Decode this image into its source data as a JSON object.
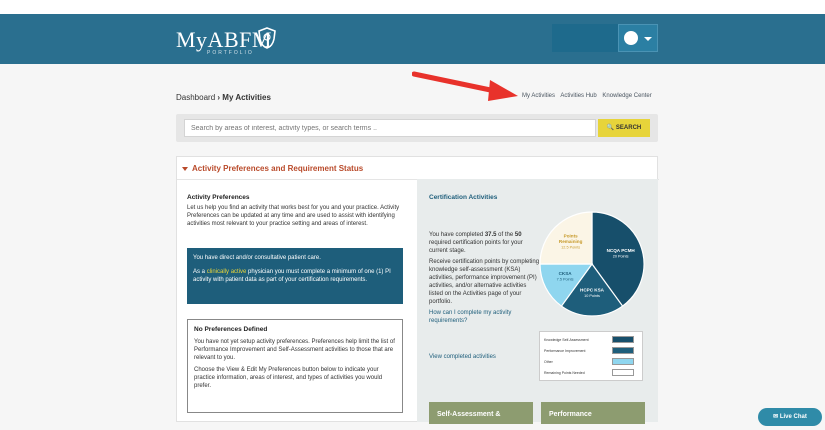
{
  "header": {
    "logo_text": "MyABFM",
    "logo_subtext": "PORTFOLIO"
  },
  "breadcrumb": {
    "home": "Dashboard",
    "separator": "›",
    "current": "My Activities"
  },
  "top_links": [
    "My Activities",
    "Activities Hub",
    "Knowledge Center"
  ],
  "search": {
    "placeholder": "Search by areas of interest, activity types, or search terms ..",
    "button_label": "SEARCH",
    "icon": "search-icon"
  },
  "section": {
    "title": "Activity Preferences and Requirement Status",
    "preferences": {
      "title": "Activity Preferences",
      "text": "Let us help you find an activity that works best for you and your practice. Activity Preferences can be updated at any time and are used to assist with identifying activities most relevant to your practice setting and areas of interest.",
      "notice_line1": "You have direct and/or consultative patient care.",
      "notice_pre": "As a ",
      "notice_highlight": "clinically active",
      "notice_post": " physician you must complete a minimum of one (1) PI activity with patient data as part of your certification requirements."
    },
    "no_prefs": {
      "title": "No Preferences Defined",
      "p1": "You have not yet setup activity preferences. Preferences help limit the list of Performance Improvement and Self-Assessment activities to those that are relevant to you.",
      "p2": "Choose the View & Edit My Preferences button below to indicate your practice information, areas of interest, and types of activities you would prefer."
    },
    "certification": {
      "title": "Certification Activities",
      "p1_pre": "You have completed ",
      "p1_completed": "37.5",
      "p1_mid": " of the ",
      "p1_required": "50",
      "p1_post": " required certification points for your current stage.",
      "p2": "Receive certification points by completing knowledge self-assessment (KSA) activities, performance improvement (PI) activities, and/or alternative activities listed on the Activities page of your portfolio.",
      "link1": "How can I complete my activity requirements?",
      "link2": "View completed activities"
    },
    "buttons": {
      "self_assessment": "Self-Assessment &",
      "performance": "Performance"
    }
  },
  "chart_data": {
    "type": "pie",
    "slices": [
      {
        "name": "NCQA PCMH",
        "value": 20,
        "label": "NCQA PCMH",
        "sublabel": "20 Points",
        "color": "#174f6b"
      },
      {
        "name": "HCPC KSA",
        "value": 10,
        "label": "HCPC KSA",
        "sublabel": "10 Points",
        "color": "#1e5e7b"
      },
      {
        "name": "CKSA",
        "value": 7.5,
        "label": "CKSA",
        "sublabel": "7.5 Points",
        "color": "#8fd6ef"
      },
      {
        "name": "Points Remaining",
        "value": 12.5,
        "label": "Points Remaining",
        "sublabel": "12.5 Points",
        "color": "#fbf5e6"
      }
    ],
    "legend": [
      {
        "label": "Knowledge Self-Assessment",
        "color": "#174f6b"
      },
      {
        "label": "Performance Improvement",
        "color": "#1e5e7b"
      },
      {
        "label": "Other",
        "color": "#8fd6ef"
      },
      {
        "label": "Remaining Points Needed",
        "color": "#ffffff"
      }
    ]
  },
  "live_chat": {
    "label": "Live Chat"
  }
}
